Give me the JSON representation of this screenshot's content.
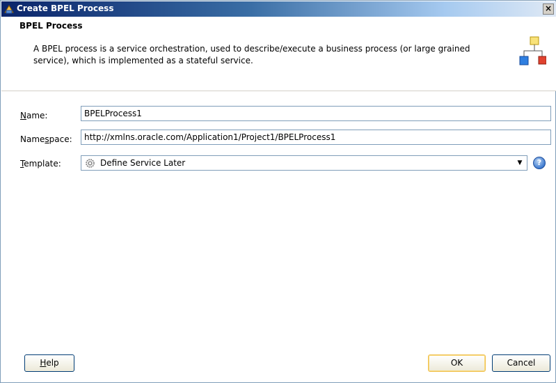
{
  "window": {
    "title": "Create BPEL Process",
    "close_label": "×"
  },
  "header": {
    "title": "BPEL Process",
    "description": "A BPEL process is a service orchestration, used to describe/execute a business process (or large grained service), which is implemented as a stateful service."
  },
  "form": {
    "name_label_mn": "N",
    "name_label_rest": "ame:",
    "name_value": "BPELProcess1",
    "namespace_label_pre": "Name",
    "namespace_label_mn": "s",
    "namespace_label_rest": "pace:",
    "namespace_value": "http://xmlns.oracle.com/Application1/Project1/BPELProcess1",
    "template_label_mn": "T",
    "template_label_rest": "emplate:",
    "template_value": "Define Service Later"
  },
  "buttons": {
    "help_mn": "H",
    "help_rest": "elp",
    "ok": "OK",
    "cancel": "Cancel"
  },
  "icons": {
    "title": "bpel-app-icon",
    "header": "process-diagram-icon",
    "template": "gear-icon",
    "help": "help-icon",
    "dropdown": "chevron-down-icon"
  },
  "colors": {
    "title_bar_start": "#0a246a",
    "title_bar_end": "#dfe9f5",
    "field_border": "#7f9db9",
    "default_button_border": "#f0c150"
  }
}
